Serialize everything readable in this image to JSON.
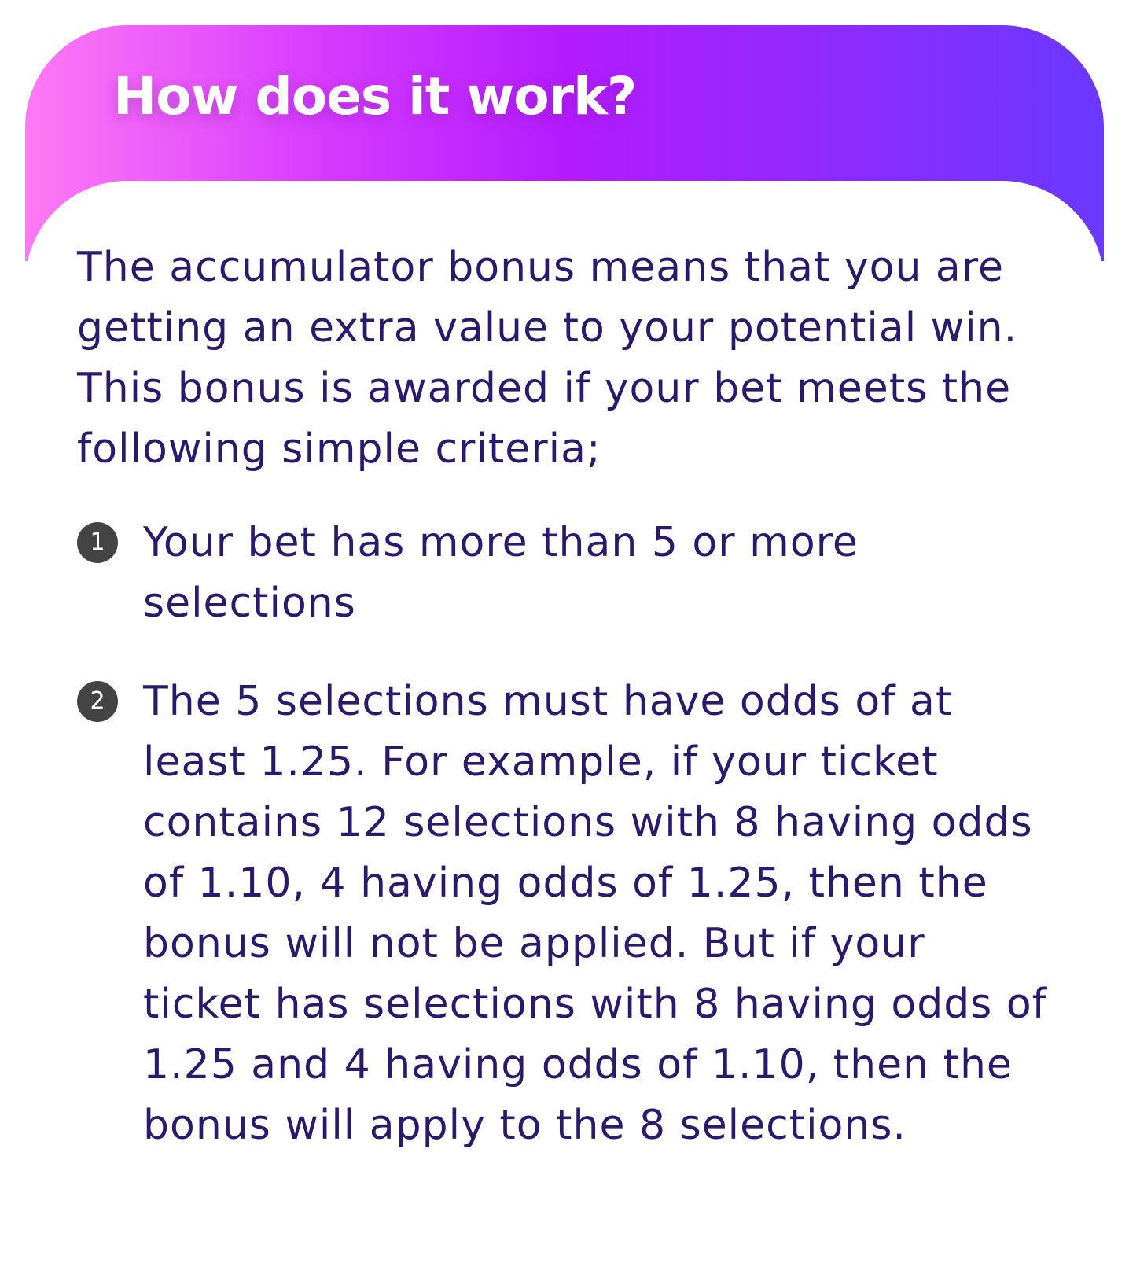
{
  "header": {
    "title": "How does it work?"
  },
  "intro": "The accumulator bonus means that you are getting an extra value to your potential win. This bonus is awarded if your bet meets the following simple criteria;",
  "criteria": [
    {
      "number": "1",
      "text": "Your bet has more than 5 or more selections"
    },
    {
      "number": "2",
      "text": "The 5 selections must have odds of at least 1.25. For example, if your ticket contains 12 selections with 8 having odds of 1.10, 4 having odds of 1.25, then the bonus will not be applied. But if your ticket has selections with 8 having odds of 1.25 and 4 having odds of 1.10, then the bonus will apply to the 8 selections."
    }
  ],
  "colors": {
    "gradient_start": "#ff7af5",
    "gradient_mid": "#b41cff",
    "gradient_end": "#6a38ff",
    "text": "#2a1a6b",
    "badge": "#444444"
  }
}
